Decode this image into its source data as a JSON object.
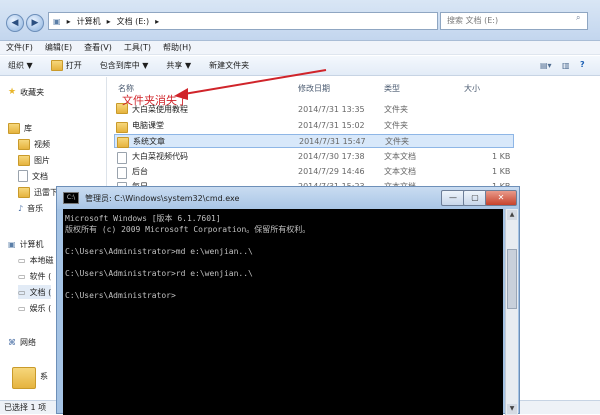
{
  "explorer": {
    "breadcrumb": {
      "root": "计算机",
      "drive": "文档 (E:)"
    },
    "search_placeholder": "搜索 文档 (E:)",
    "menu": [
      "文件(F)",
      "编辑(E)",
      "查看(V)",
      "工具(T)",
      "帮助(H)"
    ],
    "toolbar": {
      "organize": "组织 ▼",
      "open": "打开",
      "include": "包含到库中 ▼",
      "share": "共享 ▼",
      "new_folder": "新建文件夹"
    },
    "sidebar": {
      "favorites": "收藏夹",
      "library": "库",
      "library_items": [
        "视频",
        "图片",
        "文档",
        "迅雷下",
        "音乐"
      ],
      "computer": "计算机",
      "computer_items": [
        "本地磁",
        "软件 (",
        "文档 (",
        "娱乐 ("
      ],
      "network": "网络"
    },
    "columns": {
      "name": "名称",
      "modified": "修改日期",
      "type": "类型",
      "size": "大小"
    },
    "files": [
      {
        "name": "大白菜使用教程",
        "date": "2014/7/31 13:35",
        "type": "文件夹",
        "size": ""
      },
      {
        "name": "电脑课堂",
        "date": "2014/7/31 15:02",
        "type": "文件夹",
        "size": ""
      },
      {
        "name": "系统文章",
        "date": "2014/7/31 15:47",
        "type": "文件夹",
        "size": ""
      },
      {
        "name": "大白菜视频代码",
        "date": "2014/7/30 17:38",
        "type": "文本文档",
        "size": "1 KB"
      },
      {
        "name": "后台",
        "date": "2014/7/29 14:46",
        "type": "文本文档",
        "size": "1 KB"
      },
      {
        "name": "每日",
        "date": "2014/7/31 15:23",
        "type": "文本文档",
        "size": "1 KB"
      }
    ],
    "annotation": "文件夹消失了",
    "details_name": "系",
    "status": "已选择 1 项"
  },
  "cmd": {
    "title": "管理员: C:\\Windows\\system32\\cmd.exe",
    "lines": [
      "Microsoft Windows [版本 6.1.7601]",
      "版权所有 (c) 2009 Microsoft Corporation。保留所有权利。",
      "",
      "C:\\Users\\Administrator>md e:\\wenjian..\\",
      "",
      "C:\\Users\\Administrator>rd e:\\wenjian..\\",
      "",
      "C:\\Users\\Administrator>"
    ]
  },
  "colors": {
    "annotation": "#d0242a",
    "console_bg": "#000000",
    "selection": "#d8e8fa"
  }
}
